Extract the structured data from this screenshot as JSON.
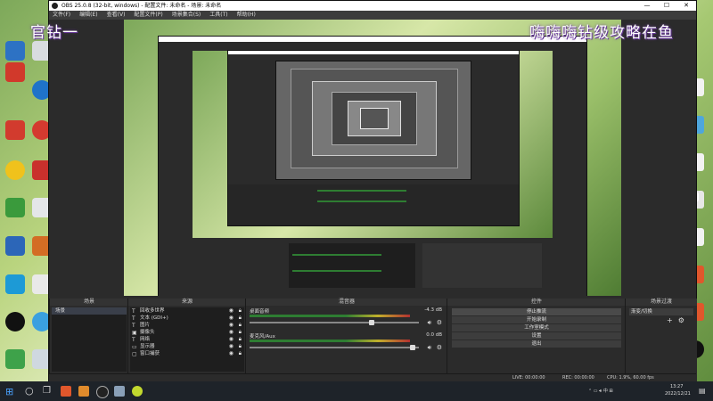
{
  "overlay": {
    "left_text": "官钻一",
    "right_text": "嗨嗨嗨钻级攻略在鱼"
  },
  "obs": {
    "title": "OBS 25.0.8 (32-bit, windows) - 配置文件: 未命名 - 场景: 未命名",
    "menu": [
      "文件(F)",
      "编辑(E)",
      "查看(V)",
      "配置文件(P)",
      "场景集合(S)",
      "工具(T)",
      "帮助(H)"
    ],
    "docks": {
      "scenes": {
        "title": "场景",
        "items": [
          "场景"
        ]
      },
      "sources": {
        "title": "来源",
        "items": [
          {
            "icon": "text",
            "label": "回收多世界"
          },
          {
            "icon": "text",
            "label": "文本 (GDI+)"
          },
          {
            "icon": "text",
            "label": "图片"
          },
          {
            "icon": "camera",
            "label": "摄像头"
          },
          {
            "icon": "text",
            "label": "网络"
          },
          {
            "icon": "display",
            "label": "显示器"
          },
          {
            "icon": "window",
            "label": "窗口捕获"
          }
        ]
      },
      "mixer": {
        "title": "混音器",
        "channels": [
          {
            "name": "桌面音频",
            "db": "-4.3 dB",
            "level": 0.8
          },
          {
            "name": "麦克风/Aux",
            "db": "0.0 dB",
            "level": 0.7
          }
        ]
      },
      "controls": {
        "title": "控件",
        "buttons": [
          "停止推流",
          "开始录制",
          "工作室模式",
          "设置",
          "退出"
        ]
      },
      "transitions": {
        "title": "场景过渡",
        "value": "渐变/切换"
      }
    },
    "status": {
      "live": "LIVE: 00:00:00",
      "rec": "REC: 00:00:00",
      "cpu": "CPU: 1.9%, 60.00 fps"
    }
  },
  "taskbar": {
    "time": "13:27",
    "date": "2022/12/21"
  }
}
